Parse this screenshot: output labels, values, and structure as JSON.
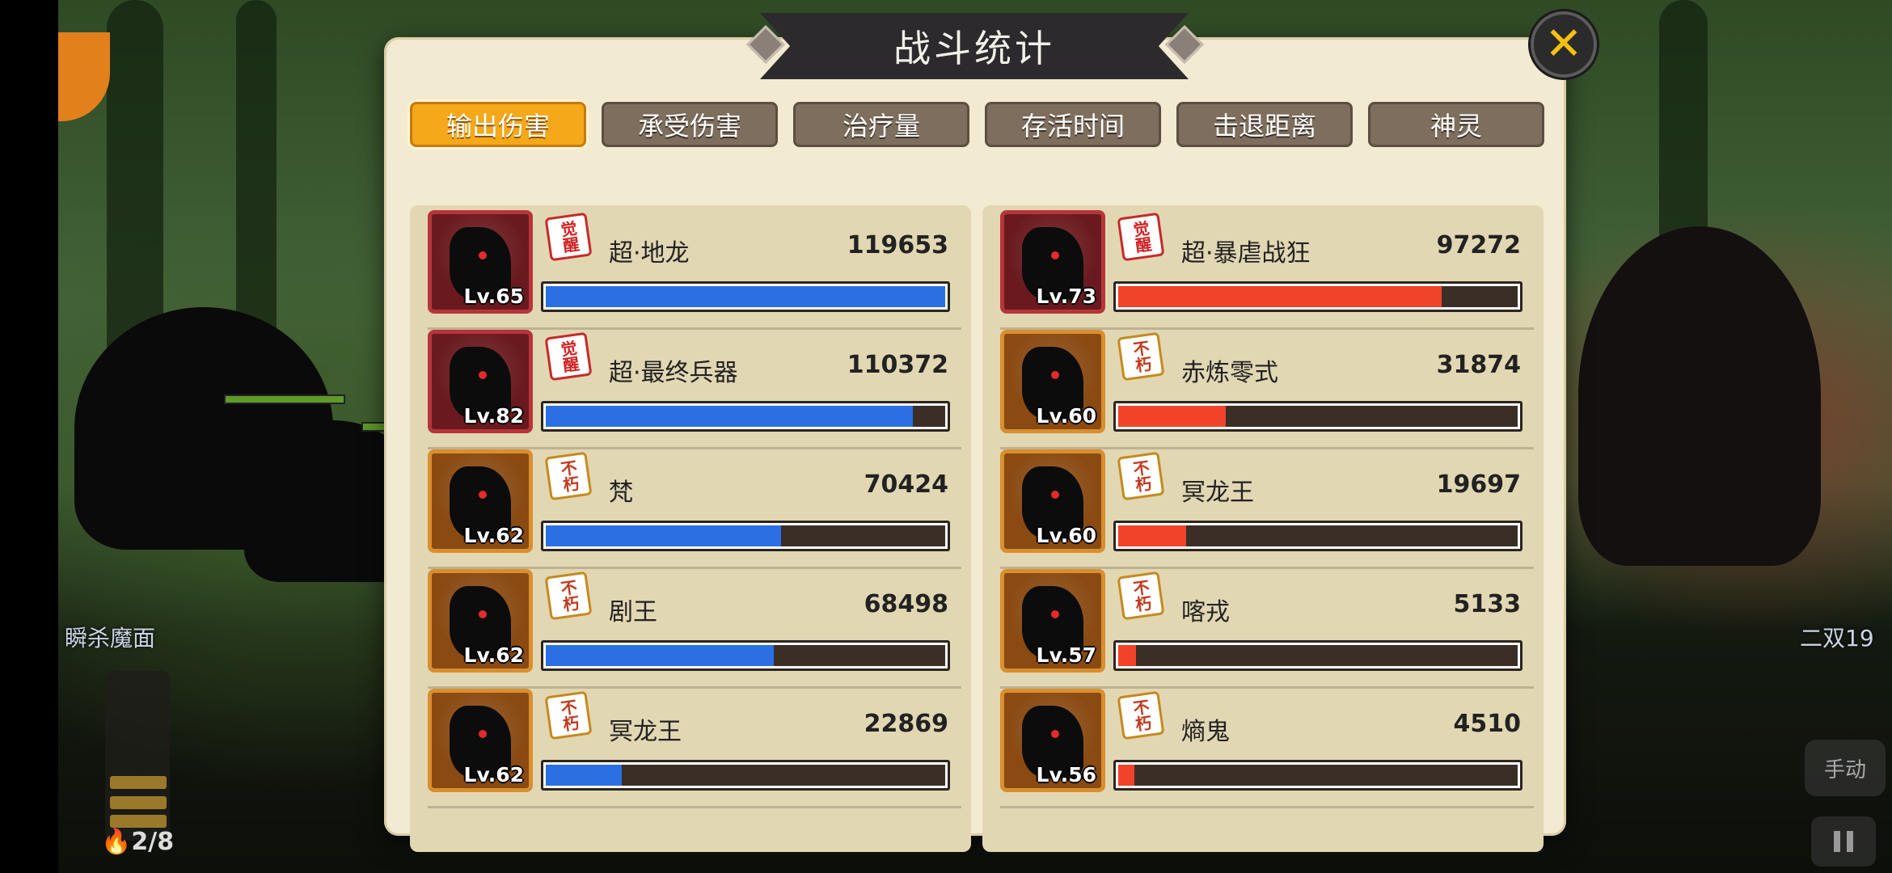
{
  "background": {
    "left_label": "瞬杀魔面",
    "right_label": "二双19",
    "energy_count": "2/8",
    "manual_button": "手动"
  },
  "modal": {
    "title": "战斗统计",
    "close_icon": "close-x-icon",
    "tabs": [
      {
        "label": "输出伤害",
        "active": true
      },
      {
        "label": "承受伤害",
        "active": false
      },
      {
        "label": "治疗量",
        "active": false
      },
      {
        "label": "存活时间",
        "active": false
      },
      {
        "label": "击退距离",
        "active": false
      },
      {
        "label": "神灵",
        "active": false
      }
    ],
    "left_team": {
      "bar_color": "#2b6fe3",
      "entries": [
        {
          "name": "超·地龙",
          "value": "119653",
          "level": "Lv.65",
          "badge": "觉醒",
          "frame": "red",
          "fill": 1.0
        },
        {
          "name": "超·最终兵器",
          "value": "110372",
          "level": "Lv.82",
          "badge": "觉醒",
          "frame": "red",
          "fill": 0.92
        },
        {
          "name": "梵",
          "value": "70424",
          "level": "Lv.62",
          "badge": "不朽",
          "frame": "gold",
          "fill": 0.59
        },
        {
          "name": "剧王",
          "value": "68498",
          "level": "Lv.62",
          "badge": "不朽",
          "frame": "gold",
          "fill": 0.57
        },
        {
          "name": "冥龙王",
          "value": "22869",
          "level": "Lv.62",
          "badge": "不朽",
          "frame": "gold",
          "fill": 0.19
        }
      ]
    },
    "right_team": {
      "bar_color": "#f0432a",
      "entries": [
        {
          "name": "超·暴虐战狂",
          "value": "97272",
          "level": "Lv.73",
          "badge": "觉醒",
          "frame": "red",
          "fill": 0.81
        },
        {
          "name": "赤炼零式",
          "value": "31874",
          "level": "Lv.60",
          "badge": "不朽",
          "frame": "gold",
          "fill": 0.27
        },
        {
          "name": "冥龙王",
          "value": "19697",
          "level": "Lv.60",
          "badge": "不朽",
          "frame": "gold",
          "fill": 0.17
        },
        {
          "name": "喀戎",
          "value": "5133",
          "level": "Lv.57",
          "badge": "不朽",
          "frame": "gold",
          "fill": 0.045
        },
        {
          "name": "熵鬼",
          "value": "4510",
          "level": "Lv.56",
          "badge": "不朽",
          "frame": "gold",
          "fill": 0.04
        }
      ]
    }
  }
}
